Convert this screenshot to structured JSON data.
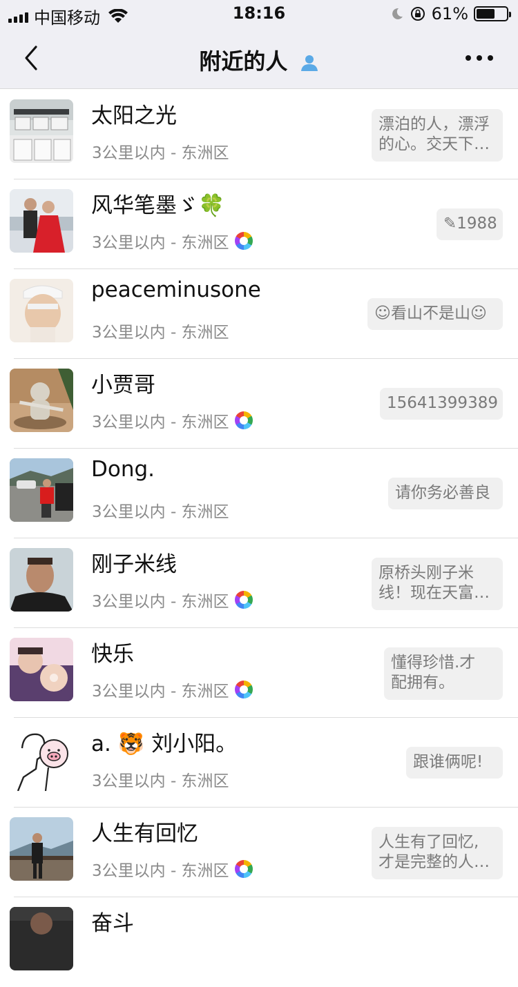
{
  "status_bar": {
    "carrier": "中国移动",
    "time": "18:16",
    "battery_percent": "61%",
    "battery_level": 0.61
  },
  "nav": {
    "title": "附近的人",
    "back_icon": "chevron-left-icon",
    "more_icon": "ellipsis-icon"
  },
  "people": [
    {
      "name": "太阳之光",
      "location": "3公里以内 - 东洲区",
      "has_moments": false,
      "signature": "漂泊的人，漂浮\n的心。交天下…"
    },
    {
      "name": "风华笔墨ゞ🍀",
      "location": "3公里以内 - 东洲区",
      "has_moments": true,
      "signature": "✎1988"
    },
    {
      "name": "peaceminusone",
      "location": "3公里以内 - 东洲区",
      "has_moments": false,
      "signature": "☺看山不是山☺"
    },
    {
      "name": "小贾哥",
      "location": "3公里以内 - 东洲区",
      "has_moments": true,
      "signature": "15641399389"
    },
    {
      "name": "Dong.",
      "location": "3公里以内 - 东洲区",
      "has_moments": false,
      "signature": "请你务必善良"
    },
    {
      "name": "刚子米线",
      "location": "3公里以内 - 东洲区",
      "has_moments": true,
      "signature": "原桥头刚子米\n线！现在天富…"
    },
    {
      "name": "快乐",
      "location": "3公里以内 - 东洲区",
      "has_moments": true,
      "signature": "懂得珍惜.才\n配拥有。"
    },
    {
      "name": "a. 🐯 刘小阳。",
      "location": "3公里以内 - 东洲区",
      "has_moments": false,
      "signature": "跟谁俩呢!"
    },
    {
      "name": "人生有回忆",
      "location": "3公里以内 - 东洲区",
      "has_moments": true,
      "signature": "人生有了回忆,\n才是完整的人…"
    },
    {
      "name": "奋斗",
      "location": "",
      "has_moments": false,
      "signature": ""
    }
  ]
}
